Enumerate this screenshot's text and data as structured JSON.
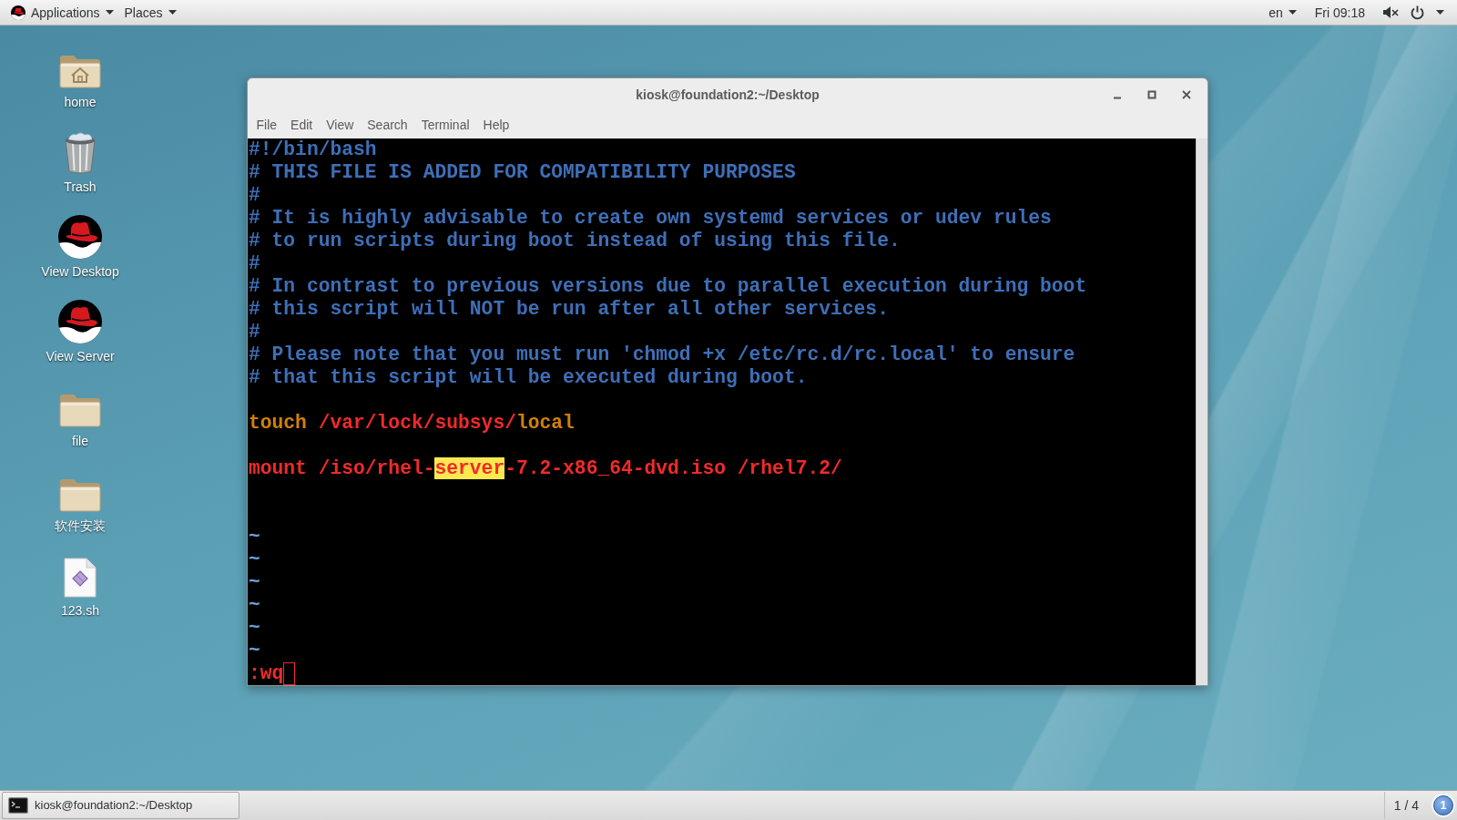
{
  "top_bar": {
    "menus": [
      "Applications",
      "Places"
    ],
    "language": "en",
    "clock": "Fri 09:18"
  },
  "desktop_icons": [
    {
      "label": "home",
      "kind": "home"
    },
    {
      "label": "Trash",
      "kind": "trash"
    },
    {
      "label": "View Desktop",
      "kind": "logo"
    },
    {
      "label": "View Server",
      "kind": "logo"
    },
    {
      "label": "file",
      "kind": "folder"
    },
    {
      "label": "软件安装",
      "kind": "folder"
    },
    {
      "label": "123.sh",
      "kind": "script"
    }
  ],
  "terminal": {
    "title": "kiosk@foundation2:~/Desktop",
    "menu": [
      "File",
      "Edit",
      "View",
      "Search",
      "Terminal",
      "Help"
    ],
    "lines": [
      {
        "kind": "text",
        "segments": [
          {
            "kind": "comment",
            "text": "#!/bin/bash"
          }
        ]
      },
      {
        "kind": "text",
        "segments": [
          {
            "kind": "comment",
            "text": "# THIS FILE IS ADDED FOR COMPATIBILITY PURPOSES"
          }
        ]
      },
      {
        "kind": "text",
        "segments": [
          {
            "kind": "comment",
            "text": "#"
          }
        ]
      },
      {
        "kind": "text",
        "segments": [
          {
            "kind": "comment",
            "text": "# It is highly advisable to create own systemd services or udev rules"
          }
        ]
      },
      {
        "kind": "text",
        "segments": [
          {
            "kind": "comment",
            "text": "# to run scripts during boot instead of using this file."
          }
        ]
      },
      {
        "kind": "text",
        "segments": [
          {
            "kind": "comment",
            "text": "#"
          }
        ]
      },
      {
        "kind": "text",
        "segments": [
          {
            "kind": "comment",
            "text": "# In contrast to previous versions due to parallel execution during boot"
          }
        ]
      },
      {
        "kind": "text",
        "segments": [
          {
            "kind": "comment",
            "text": "# this script will NOT be run after all other services."
          }
        ]
      },
      {
        "kind": "text",
        "segments": [
          {
            "kind": "comment",
            "text": "#"
          }
        ]
      },
      {
        "kind": "text",
        "segments": [
          {
            "kind": "comment",
            "text": "# Please note that you must run 'chmod +x /etc/rc.d/rc.local' to ensure"
          }
        ]
      },
      {
        "kind": "text",
        "segments": [
          {
            "kind": "comment",
            "text": "# that this script will be executed during boot."
          }
        ]
      },
      {
        "kind": "blank"
      },
      {
        "kind": "text",
        "segments": [
          {
            "kind": "keyword",
            "text": "touch"
          },
          {
            "kind": "plain",
            "text": " /var/lock/subsys/"
          },
          {
            "kind": "keyword",
            "text": "local"
          }
        ]
      },
      {
        "kind": "blank"
      },
      {
        "kind": "text",
        "segments": [
          {
            "kind": "plain",
            "text": "mount /iso/rhel-"
          },
          {
            "kind": "match",
            "text": "server"
          },
          {
            "kind": "plain",
            "text": "-7.2-x86_64-dvd.iso /rhel7.2/"
          }
        ]
      },
      {
        "kind": "blank"
      },
      {
        "kind": "blank"
      },
      {
        "kind": "filler",
        "text": "~"
      },
      {
        "kind": "filler",
        "text": "~"
      },
      {
        "kind": "filler",
        "text": "~"
      },
      {
        "kind": "filler",
        "text": "~"
      },
      {
        "kind": "filler",
        "text": "~"
      },
      {
        "kind": "filler",
        "text": "~"
      }
    ],
    "command_line": ":wq"
  },
  "taskbar": {
    "window_button": "kiosk@foundation2:~/Desktop",
    "workspace": "1 / 4",
    "message_count": "1"
  }
}
